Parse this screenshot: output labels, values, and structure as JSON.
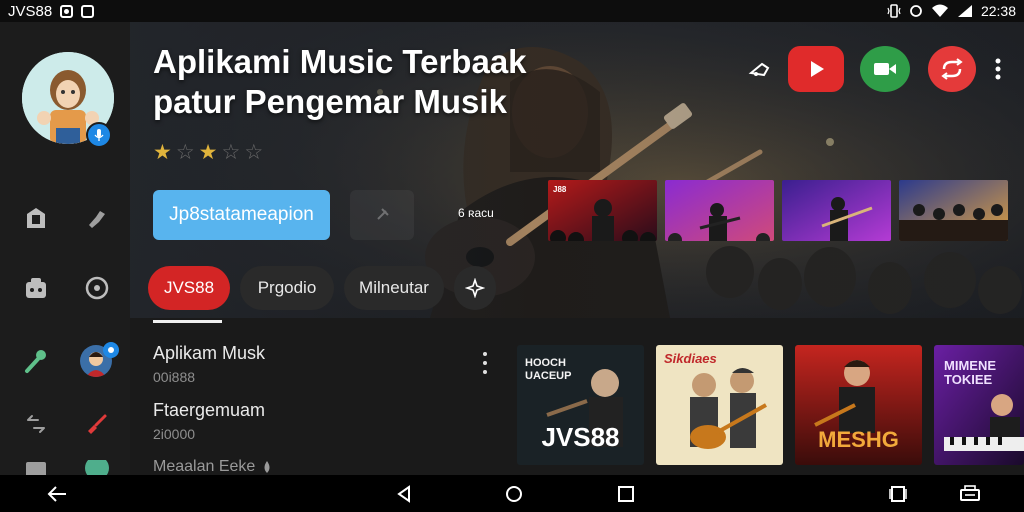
{
  "status_bar": {
    "carrier": "JVS88",
    "time": "22:38"
  },
  "hero": {
    "title_line1": "Aplikami Music Terbaak",
    "title_line2": "patur Pengemar Musik",
    "rating_stars": 2,
    "rating_max": 5,
    "cta_label": "Jp8statameapion",
    "artist_tag": "6 ʀacu",
    "thumbnails": [
      {
        "label": "J88",
        "colors": [
          "#b41a1a",
          "#2a0c1a"
        ]
      },
      {
        "label": "",
        "colors": [
          "#8a2bd1",
          "#d04a7a"
        ]
      },
      {
        "label": "",
        "colors": [
          "#3a1f8f",
          "#b43bd4"
        ]
      },
      {
        "label": "",
        "colors": [
          "#2c3a8c",
          "#e0a340"
        ]
      }
    ]
  },
  "tabs": [
    {
      "label": "JVS88",
      "active": true
    },
    {
      "label": "Prgodio",
      "active": false
    },
    {
      "label": "Milneutar",
      "active": false
    }
  ],
  "list": [
    {
      "title": "Aplikam Musk",
      "subtitle": "00i888"
    },
    {
      "title": "Ftaergemuam",
      "subtitle": "2i0000"
    },
    {
      "title": "Meaalan Eeke",
      "subtitle": ""
    }
  ],
  "albums": [
    {
      "top_text": "HOOCH UACEUP",
      "bottom_text": "JVS88",
      "accent": "#ffffff",
      "bg": [
        "#1f2a2e",
        "#121518"
      ]
    },
    {
      "top_text": "Sikdiaes",
      "bottom_text": "",
      "accent": "#c0282b",
      "bg": [
        "#f3e9c8",
        "#e6d7a8"
      ]
    },
    {
      "top_text": "",
      "bottom_text": "MESHG",
      "accent": "#f2a93b",
      "bg": [
        "#c5251f",
        "#3a0c0a"
      ]
    },
    {
      "top_text": "MIMENE TOKIEE",
      "bottom_text": "",
      "accent": "#f0e0ff",
      "bg": [
        "#6a1fa3",
        "#1a0a2b"
      ]
    }
  ],
  "colors": {
    "accent_red": "#d32525",
    "cta_blue": "#58b4ee",
    "star_gold": "#e0b43c"
  },
  "icons": {
    "hero_actions": [
      "share-icon",
      "play-icon",
      "video-icon",
      "repeat-icon",
      "more-vert-icon"
    ],
    "sidebar": [
      "library-icon",
      "hand-icon",
      "radio-icon",
      "compass-icon",
      "mic-icon",
      "user-avatar-icon",
      "crossfade-icon",
      "guitar-icon"
    ],
    "navbar": [
      "back-icon",
      "home-icon",
      "recents-icon",
      "screen-icon",
      "keyboard-icon"
    ]
  }
}
